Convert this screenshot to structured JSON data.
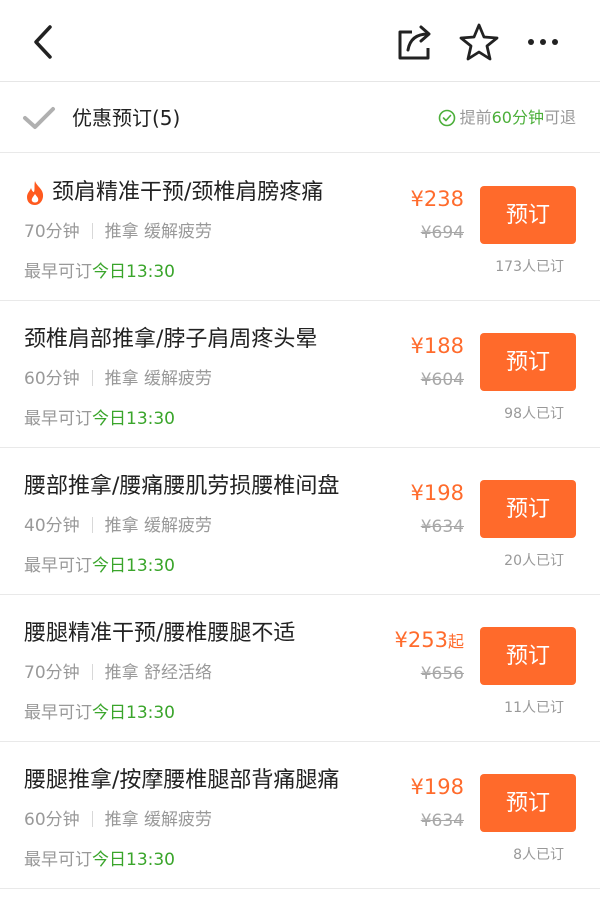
{
  "navbar": {
    "back_icon": "chevron-left-icon",
    "share_icon": "share-icon",
    "star_icon": "star-icon",
    "more_icon": "more-dots-icon"
  },
  "section": {
    "title": "优惠预订(5)",
    "refund_prefix": "提前",
    "refund_highlight": "60分钟",
    "refund_suffix": "可退"
  },
  "items": [
    {
      "title": "颈肩精准干预/颈椎肩膀疼痛",
      "hot": true,
      "duration": "70分钟",
      "tags": "推拿 缓解疲劳",
      "earliest_label": "最早可订",
      "earliest_time": "今日13:30",
      "price": "¥238",
      "price_suffix": "",
      "original_price": "¥694",
      "button": "预订",
      "sold": "173人已订"
    },
    {
      "title": "颈椎肩部推拿/脖子肩周疼头晕",
      "hot": false,
      "duration": "60分钟",
      "tags": "推拿 缓解疲劳",
      "earliest_label": "最早可订",
      "earliest_time": "今日13:30",
      "price": "¥188",
      "price_suffix": "",
      "original_price": "¥604",
      "button": "预订",
      "sold": "98人已订"
    },
    {
      "title": "腰部推拿/腰痛腰肌劳损腰椎间盘",
      "hot": false,
      "duration": "40分钟",
      "tags": "推拿 缓解疲劳",
      "earliest_label": "最早可订",
      "earliest_time": "今日13:30",
      "price": "¥198",
      "price_suffix": "",
      "original_price": "¥634",
      "button": "预订",
      "sold": "20人已订"
    },
    {
      "title": "腰腿精准干预/腰椎腰腿不适",
      "hot": false,
      "duration": "70分钟",
      "tags": "推拿 舒经活络",
      "earliest_label": "最早可订",
      "earliest_time": "今日13:30",
      "price": "¥253",
      "price_suffix": "起",
      "original_price": "¥656",
      "button": "预订",
      "sold": "11人已订"
    },
    {
      "title": "腰腿推拿/按摩腰椎腿部背痛腿痛",
      "hot": false,
      "duration": "60分钟",
      "tags": "推拿 缓解疲劳",
      "earliest_label": "最早可订",
      "earliest_time": "今日13:30",
      "price": "¥198",
      "price_suffix": "",
      "original_price": "¥634",
      "button": "预订",
      "sold": "8人已订"
    }
  ],
  "colors": {
    "accent": "#ff6a2b",
    "price": "#ff6b2c",
    "green": "#3aa52b"
  }
}
